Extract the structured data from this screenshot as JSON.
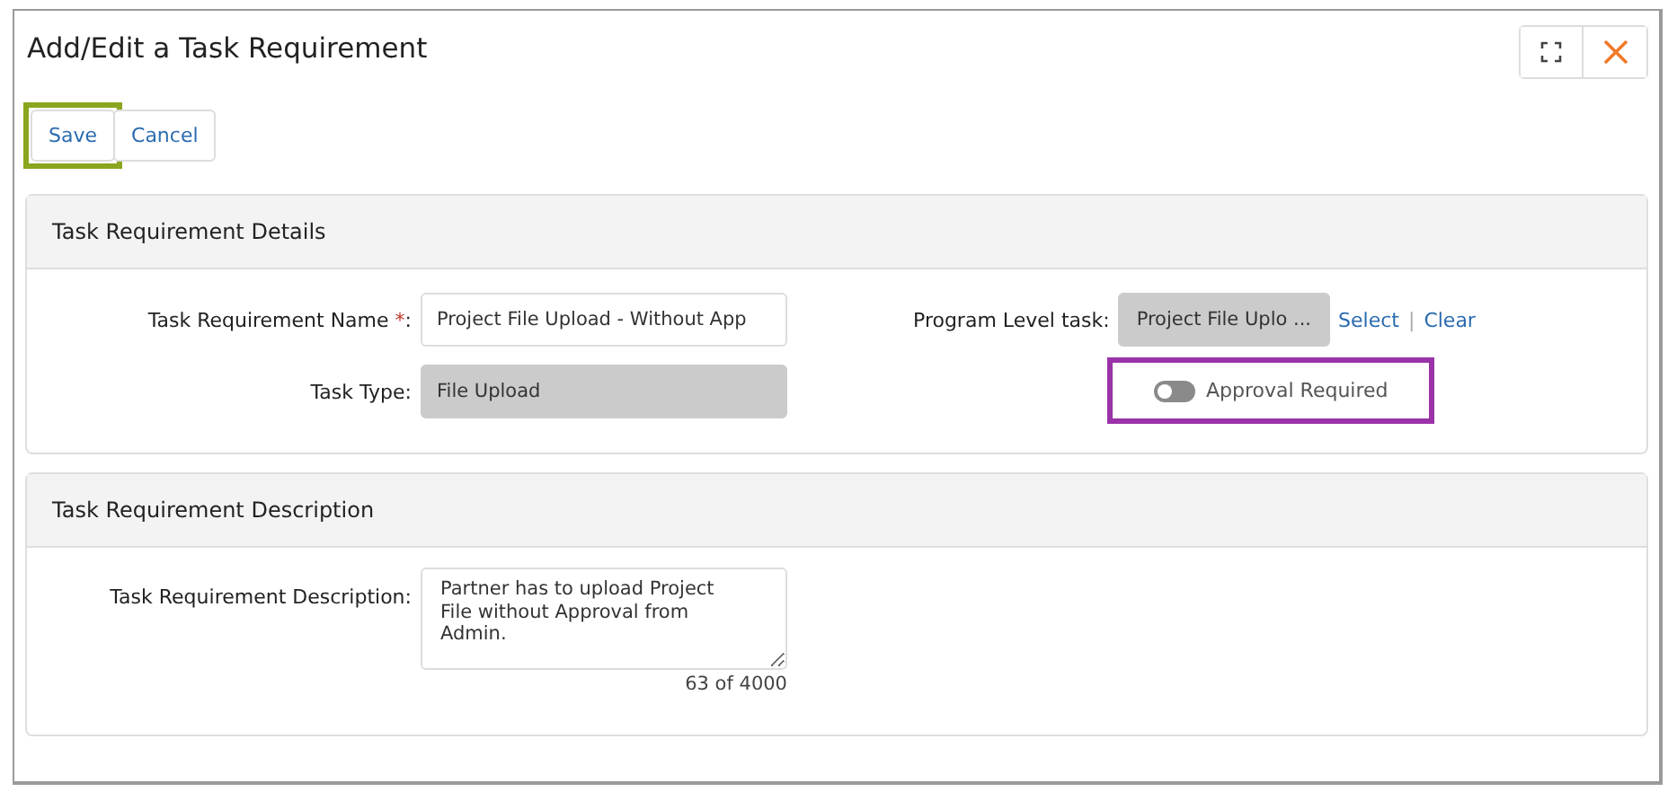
{
  "window": {
    "title": "Add/Edit a Task Requirement"
  },
  "toolbar": [
    {
      "label": "Save",
      "highlighted": true,
      "color": "#8aa61e"
    },
    {
      "label": "Cancel",
      "highlighted": false
    }
  ],
  "details": {
    "title": "Task Requirement Details",
    "name_field": {
      "label": "Task Requirement Name",
      "required_mark": "*",
      "suffix": ":",
      "value": "Project File Upload - Without App"
    },
    "type_field": {
      "label": "Task Type:",
      "value": "File Upload",
      "disabled": true
    },
    "program_task": {
      "label": "Program Level task:",
      "value": "Project File Uplo ...",
      "links": [
        "Select",
        "Clear"
      ],
      "link_separator": "|"
    },
    "approval": {
      "label": "Approval Required",
      "on": false,
      "highlighted": true,
      "color": "#9a32a8"
    }
  },
  "description": {
    "title": "Task Requirement Description",
    "field": {
      "label": "Task Requirement Description:",
      "value": "Partner has to upload Project\nFile without Approval from\nAdmin.",
      "counter": "63 of 4000"
    }
  }
}
